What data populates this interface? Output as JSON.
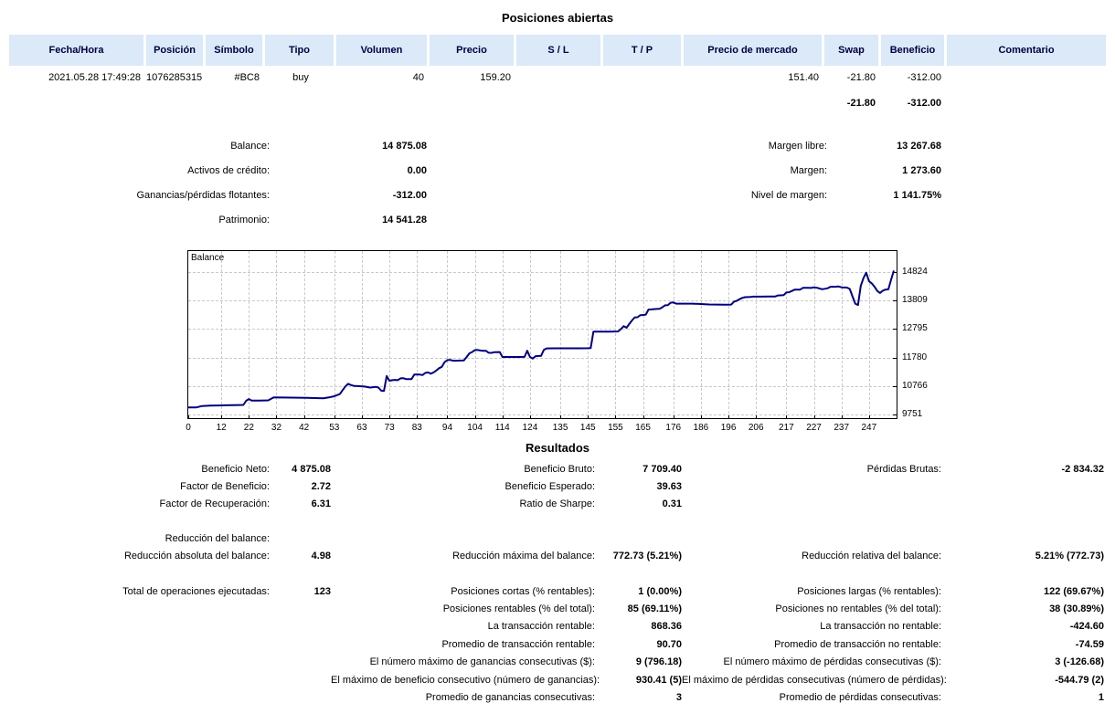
{
  "title": "Posiciones abiertas",
  "table": {
    "columns": [
      "Fecha/Hora",
      "Posición",
      "Símbolo",
      "Tipo",
      "Volumen",
      "Precio",
      "S / L",
      "T / P",
      "Precio de mercado",
      "Swap",
      "Beneficio",
      "Comentario"
    ],
    "row": {
      "fecha": "2021.05.28 17:49:28",
      "posicion": "1076285315",
      "simbolo": "#BC8",
      "tipo": "buy",
      "volumen": "40",
      "precio": "159.20",
      "sl": "",
      "tp": "",
      "precio_mercado": "151.40",
      "swap": "-21.80",
      "beneficio": "-312.00",
      "comentario": ""
    },
    "totals": {
      "swap": "-21.80",
      "beneficio": "-312.00"
    }
  },
  "account": {
    "rows": [
      {
        "l1": "Balance:",
        "v1": "14 875.08",
        "l2": "Margen libre:",
        "v2": "13 267.68"
      },
      {
        "l1": "Activos de crédito:",
        "v1": "0.00",
        "l2": "Margen:",
        "v2": "1 273.60"
      },
      {
        "l1": "Ganancias/pérdidas flotantes:",
        "v1": "-312.00",
        "l2": "Nivel de margen:",
        "v2": "1 141.75%"
      },
      {
        "l1": "Patrimonio:",
        "v1": "14 541.28",
        "l2": "",
        "v2": ""
      }
    ]
  },
  "chart_data": {
    "type": "line",
    "title": "Balance",
    "xlabel": "",
    "ylabel": "",
    "grid": true,
    "legend_position": "none",
    "line_color": "#000080",
    "x_range": [
      0,
      257
    ],
    "y_range": [
      9621,
      15572
    ],
    "x_ticks": [
      0,
      12,
      22,
      32,
      42,
      53,
      63,
      73,
      83,
      94,
      104,
      114,
      124,
      135,
      145,
      155,
      165,
      176,
      186,
      196,
      206,
      217,
      227,
      237,
      247
    ],
    "y_ticks": [
      14824,
      13809,
      12795,
      11780,
      10766,
      9751
    ],
    "series": [
      {
        "name": "Balance",
        "points": [
          [
            0,
            10000
          ],
          [
            3,
            10005
          ],
          [
            5,
            10055
          ],
          [
            8,
            10065
          ],
          [
            11,
            10072
          ],
          [
            14,
            10078
          ],
          [
            17,
            10085
          ],
          [
            20,
            10092
          ],
          [
            21,
            10240
          ],
          [
            22,
            10300
          ],
          [
            23,
            10245
          ],
          [
            26,
            10250
          ],
          [
            29,
            10255
          ],
          [
            31,
            10358
          ],
          [
            34,
            10357
          ],
          [
            37,
            10354
          ],
          [
            40,
            10350
          ],
          [
            43,
            10345
          ],
          [
            46,
            10338
          ],
          [
            49,
            10330
          ],
          [
            51,
            10360
          ],
          [
            53,
            10400
          ],
          [
            55,
            10480
          ],
          [
            56,
            10620
          ],
          [
            57,
            10750
          ],
          [
            58,
            10845
          ],
          [
            59,
            10800
          ],
          [
            60,
            10772
          ],
          [
            62,
            10760
          ],
          [
            64,
            10745
          ],
          [
            66,
            10712
          ],
          [
            68,
            10735
          ],
          [
            69,
            10710
          ],
          [
            70,
            10600
          ],
          [
            71,
            10590
          ],
          [
            72,
            11120
          ],
          [
            73,
            10950
          ],
          [
            74,
            10975
          ],
          [
            75,
            10985
          ],
          [
            76,
            10975
          ],
          [
            77,
            11040
          ],
          [
            78,
            11045
          ],
          [
            79,
            11012
          ],
          [
            81,
            11010
          ],
          [
            82,
            11175
          ],
          [
            83,
            11180
          ],
          [
            84,
            11172
          ],
          [
            85,
            11155
          ],
          [
            86,
            11230
          ],
          [
            87,
            11250
          ],
          [
            88,
            11205
          ],
          [
            89,
            11250
          ],
          [
            90,
            11320
          ],
          [
            91,
            11400
          ],
          [
            92,
            11450
          ],
          [
            93,
            11615
          ],
          [
            94,
            11690
          ],
          [
            95,
            11695
          ],
          [
            96,
            11670
          ],
          [
            97,
            11665
          ],
          [
            98,
            11670
          ],
          [
            100,
            11680
          ],
          [
            101,
            11800
          ],
          [
            102,
            11930
          ],
          [
            103,
            11975
          ],
          [
            104,
            12045
          ],
          [
            105,
            12050
          ],
          [
            106,
            12030
          ],
          [
            107,
            12020
          ],
          [
            108,
            12020
          ],
          [
            109,
            11950
          ],
          [
            110,
            11945
          ],
          [
            111,
            11970
          ],
          [
            113,
            11975
          ],
          [
            114,
            11800
          ],
          [
            117,
            11800
          ],
          [
            120,
            11800
          ],
          [
            122,
            11802
          ],
          [
            123,
            12020
          ],
          [
            124,
            11800
          ],
          [
            125,
            11745
          ],
          [
            126,
            11830
          ],
          [
            128,
            11840
          ],
          [
            129,
            12050
          ],
          [
            130,
            12105
          ],
          [
            133,
            12110
          ],
          [
            137,
            12110
          ],
          [
            141,
            12110
          ],
          [
            145,
            12112
          ],
          [
            146,
            12115
          ],
          [
            147,
            12700
          ],
          [
            150,
            12700
          ],
          [
            153,
            12702
          ],
          [
            156,
            12710
          ],
          [
            157,
            12795
          ],
          [
            158,
            12900
          ],
          [
            159,
            12840
          ],
          [
            160,
            12975
          ],
          [
            161,
            13100
          ],
          [
            162,
            13210
          ],
          [
            163,
            13215
          ],
          [
            164,
            13290
          ],
          [
            165,
            13295
          ],
          [
            166,
            13310
          ],
          [
            167,
            13490
          ],
          [
            168,
            13495
          ],
          [
            170,
            13510
          ],
          [
            171,
            13515
          ],
          [
            172,
            13570
          ],
          [
            173,
            13640
          ],
          [
            174,
            13645
          ],
          [
            175,
            13730
          ],
          [
            176,
            13740
          ],
          [
            177,
            13700
          ],
          [
            180,
            13700
          ],
          [
            183,
            13698
          ],
          [
            186,
            13685
          ],
          [
            189,
            13670
          ],
          [
            192,
            13665
          ],
          [
            195,
            13660
          ],
          [
            197,
            13665
          ],
          [
            198,
            13770
          ],
          [
            199,
            13800
          ],
          [
            200,
            13855
          ],
          [
            201,
            13905
          ],
          [
            202,
            13930
          ],
          [
            204,
            13935
          ],
          [
            205,
            13950
          ],
          [
            208,
            13950
          ],
          [
            211,
            13952
          ],
          [
            213,
            13955
          ],
          [
            214,
            13990
          ],
          [
            216,
            14000
          ],
          [
            217,
            14100
          ],
          [
            218,
            14105
          ],
          [
            219,
            14150
          ],
          [
            220,
            14195
          ],
          [
            222,
            14200
          ],
          [
            223,
            14260
          ],
          [
            225,
            14265
          ],
          [
            226,
            14258
          ],
          [
            227,
            14280
          ],
          [
            228,
            14268
          ],
          [
            229,
            14240
          ],
          [
            230,
            14212
          ],
          [
            231,
            14230
          ],
          [
            232,
            14250
          ],
          [
            233,
            14300
          ],
          [
            235,
            14305
          ],
          [
            236,
            14310
          ],
          [
            237,
            14280
          ],
          [
            239,
            14270
          ],
          [
            240,
            14225
          ],
          [
            242,
            13700
          ],
          [
            243,
            13650
          ],
          [
            244,
            14330
          ],
          [
            245,
            14610
          ],
          [
            246,
            14800
          ],
          [
            247,
            14500
          ],
          [
            248,
            14420
          ],
          [
            249,
            14300
          ],
          [
            250,
            14150
          ],
          [
            251,
            14080
          ],
          [
            252,
            14160
          ],
          [
            253,
            14200
          ],
          [
            254,
            14210
          ],
          [
            255,
            14550
          ],
          [
            256,
            14875
          ]
        ]
      }
    ]
  },
  "results": {
    "heading": "Resultados",
    "rows": [
      {
        "c1l": "Beneficio Neto:",
        "c1v": "4 875.08",
        "c2l": "Beneficio Bruto:",
        "c2v": "7 709.40",
        "c3l": "Pérdidas Brutas:",
        "c3v": "-2 834.32"
      },
      {
        "c1l": "Factor de Beneficio:",
        "c1v": "2.72",
        "c2l": "Beneficio Esperado:",
        "c2v": "39.63",
        "c3l": "",
        "c3v": ""
      },
      {
        "c1l": "Factor de Recuperación:",
        "c1v": "6.31",
        "c2l": "Ratio de Sharpe:",
        "c2v": "0.31",
        "c3l": "",
        "c3v": ""
      },
      {
        "c1l": "Reducción del balance:",
        "c1v": "",
        "c2l": "",
        "c2v": "",
        "c3l": "",
        "c3v": ""
      },
      {
        "c1l": "Reducción absoluta del balance:",
        "c1v": "4.98",
        "c2l": "Reducción máxima del balance:",
        "c2v": "772.73 (5.21%)",
        "c3l": "Reducción relativa del balance:",
        "c3v": "5.21% (772.73)"
      },
      {
        "c1l": "Total de operaciones ejecutadas:",
        "c1v": "123",
        "c2l": "Posiciones cortas (% rentables):",
        "c2v": "1 (0.00%)",
        "c3l": "Posiciones largas (% rentables):",
        "c3v": "122 (69.67%)"
      },
      {
        "c1l": "",
        "c1v": "",
        "c2l": "Posiciones rentables (% del total):",
        "c2v": "85 (69.11%)",
        "c3l": "Posiciones no rentables (% del total):",
        "c3v": "38 (30.89%)"
      },
      {
        "c1l": "",
        "c1v": "",
        "c2l": "La transacción rentable:",
        "c2v": "868.36",
        "c3l": "La transacción no rentable:",
        "c3v": "-424.60"
      },
      {
        "c1l": "",
        "c1v": "",
        "c2l": "Promedio de transacción rentable:",
        "c2v": "90.70",
        "c3l": "Promedio de transacción no rentable:",
        "c3v": "-74.59"
      },
      {
        "c1l": "",
        "c1v": "",
        "c2l": "El número máximo de ganancias consecutivas ($):",
        "c2v": "9 (796.18)",
        "c3l": "El número máximo de pérdidas consecutivas ($):",
        "c3v": "3 (-126.68)"
      },
      {
        "c1l": "",
        "c1v": "",
        "c2l": "El máximo de beneficio consecutivo (número de ganancias):",
        "c2v": "930.41 (5)",
        "c3l": "El máximo de pérdidas consecutivas (número de pérdidas):",
        "c3v": "-544.79 (2)"
      },
      {
        "c1l": "",
        "c1v": "",
        "c2l": "Promedio de ganancias consecutivas:",
        "c2v": "3",
        "c3l": "Promedio de pérdidas consecutivas:",
        "c3v": "1"
      }
    ]
  }
}
